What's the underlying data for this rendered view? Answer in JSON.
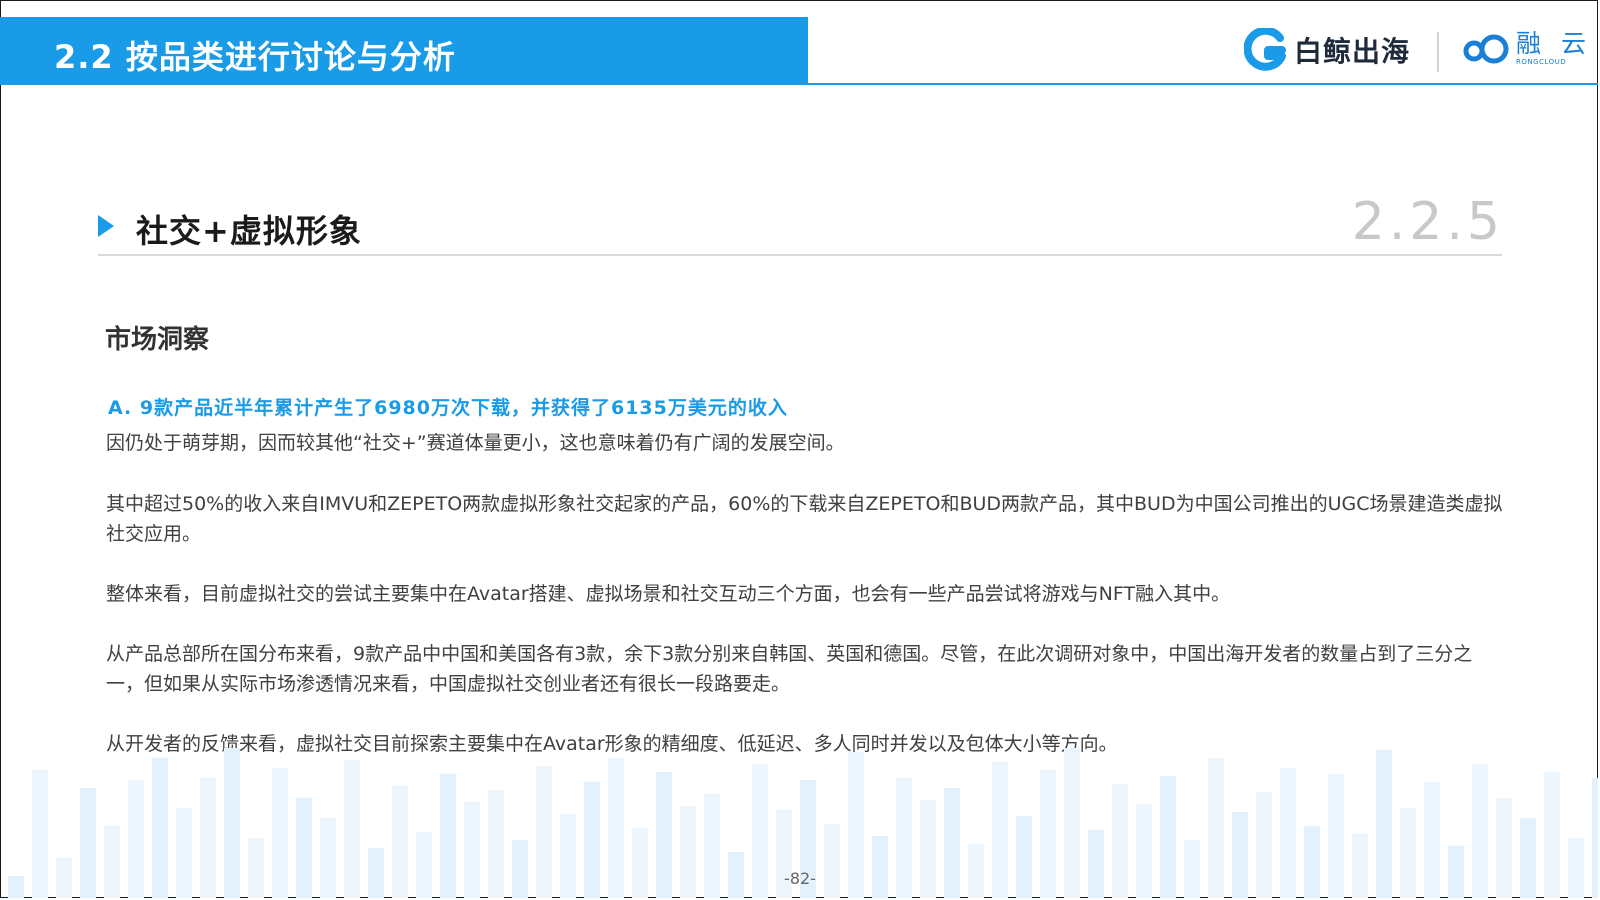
{
  "header": {
    "title": "2.2 按品类进行讨论与分析",
    "logo_baijing": "白鲸出海",
    "logo_rongyun": "融 云",
    "logo_rongyun_sub": "RONGCLOUD",
    "accent_color": "#1a9be8"
  },
  "section": {
    "title": "社交+虚拟形象",
    "number": "2.2.5"
  },
  "content": {
    "subheading": "市场洞察",
    "highlight": "A. 9款产品近半年累计产生了6980万次下载，并获得了6135万美元的收入",
    "paragraphs": [
      "因仍处于萌芽期，因而较其他“社交+”赛道体量更小，这也意味着仍有广阔的发展空间。",
      "其中超过50%的收入来自IMVU和ZEPETO两款虚拟形象社交起家的产品，60%的下载来自ZEPETO和BUD两款产品，其中BUD为中国公司推出的UGC场景建造类虚拟社交应用。",
      "整体来看，目前虚拟社交的尝试主要集中在Avatar搭建、虚拟场景和社交互动三个方面，也会有一些产品尝试将游戏与NFT融入其中。",
      "从产品总部所在国分布来看，9款产品中中国和美国各有3款，余下3款分别来自韩国、英国和德国。尽管，在此次调研对象中，中国出海开发者的数量占到了三分之一，但如果从实际市场渗透情况来看，中国虚拟社交创业者还有很长一段路要走。",
      "从开发者的反馈来看，虚拟社交目前探索主要集中在Avatar形象的精细度、低延迟、多人同时并发以及包体大小等方向。"
    ]
  },
  "footer": {
    "page_number": "-82-"
  }
}
